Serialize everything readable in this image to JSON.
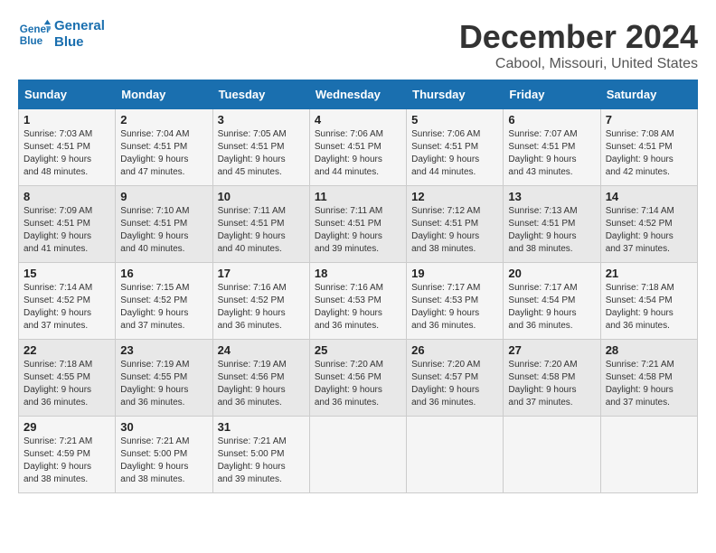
{
  "logo": {
    "line1": "General",
    "line2": "Blue"
  },
  "title": "December 2024",
  "location": "Cabool, Missouri, United States",
  "weekdays": [
    "Sunday",
    "Monday",
    "Tuesday",
    "Wednesday",
    "Thursday",
    "Friday",
    "Saturday"
  ],
  "weeks": [
    [
      {
        "day": "1",
        "sunrise": "7:03 AM",
        "sunset": "4:51 PM",
        "daylight": "9 hours and 48 minutes."
      },
      {
        "day": "2",
        "sunrise": "7:04 AM",
        "sunset": "4:51 PM",
        "daylight": "9 hours and 47 minutes."
      },
      {
        "day": "3",
        "sunrise": "7:05 AM",
        "sunset": "4:51 PM",
        "daylight": "9 hours and 45 minutes."
      },
      {
        "day": "4",
        "sunrise": "7:06 AM",
        "sunset": "4:51 PM",
        "daylight": "9 hours and 44 minutes."
      },
      {
        "day": "5",
        "sunrise": "7:06 AM",
        "sunset": "4:51 PM",
        "daylight": "9 hours and 44 minutes."
      },
      {
        "day": "6",
        "sunrise": "7:07 AM",
        "sunset": "4:51 PM",
        "daylight": "9 hours and 43 minutes."
      },
      {
        "day": "7",
        "sunrise": "7:08 AM",
        "sunset": "4:51 PM",
        "daylight": "9 hours and 42 minutes."
      }
    ],
    [
      {
        "day": "8",
        "sunrise": "7:09 AM",
        "sunset": "4:51 PM",
        "daylight": "9 hours and 41 minutes."
      },
      {
        "day": "9",
        "sunrise": "7:10 AM",
        "sunset": "4:51 PM",
        "daylight": "9 hours and 40 minutes."
      },
      {
        "day": "10",
        "sunrise": "7:11 AM",
        "sunset": "4:51 PM",
        "daylight": "9 hours and 40 minutes."
      },
      {
        "day": "11",
        "sunrise": "7:11 AM",
        "sunset": "4:51 PM",
        "daylight": "9 hours and 39 minutes."
      },
      {
        "day": "12",
        "sunrise": "7:12 AM",
        "sunset": "4:51 PM",
        "daylight": "9 hours and 38 minutes."
      },
      {
        "day": "13",
        "sunrise": "7:13 AM",
        "sunset": "4:51 PM",
        "daylight": "9 hours and 38 minutes."
      },
      {
        "day": "14",
        "sunrise": "7:14 AM",
        "sunset": "4:52 PM",
        "daylight": "9 hours and 37 minutes."
      }
    ],
    [
      {
        "day": "15",
        "sunrise": "7:14 AM",
        "sunset": "4:52 PM",
        "daylight": "9 hours and 37 minutes."
      },
      {
        "day": "16",
        "sunrise": "7:15 AM",
        "sunset": "4:52 PM",
        "daylight": "9 hours and 37 minutes."
      },
      {
        "day": "17",
        "sunrise": "7:16 AM",
        "sunset": "4:52 PM",
        "daylight": "9 hours and 36 minutes."
      },
      {
        "day": "18",
        "sunrise": "7:16 AM",
        "sunset": "4:53 PM",
        "daylight": "9 hours and 36 minutes."
      },
      {
        "day": "19",
        "sunrise": "7:17 AM",
        "sunset": "4:53 PM",
        "daylight": "9 hours and 36 minutes."
      },
      {
        "day": "20",
        "sunrise": "7:17 AM",
        "sunset": "4:54 PM",
        "daylight": "9 hours and 36 minutes."
      },
      {
        "day": "21",
        "sunrise": "7:18 AM",
        "sunset": "4:54 PM",
        "daylight": "9 hours and 36 minutes."
      }
    ],
    [
      {
        "day": "22",
        "sunrise": "7:18 AM",
        "sunset": "4:55 PM",
        "daylight": "9 hours and 36 minutes."
      },
      {
        "day": "23",
        "sunrise": "7:19 AM",
        "sunset": "4:55 PM",
        "daylight": "9 hours and 36 minutes."
      },
      {
        "day": "24",
        "sunrise": "7:19 AM",
        "sunset": "4:56 PM",
        "daylight": "9 hours and 36 minutes."
      },
      {
        "day": "25",
        "sunrise": "7:20 AM",
        "sunset": "4:56 PM",
        "daylight": "9 hours and 36 minutes."
      },
      {
        "day": "26",
        "sunrise": "7:20 AM",
        "sunset": "4:57 PM",
        "daylight": "9 hours and 36 minutes."
      },
      {
        "day": "27",
        "sunrise": "7:20 AM",
        "sunset": "4:58 PM",
        "daylight": "9 hours and 37 minutes."
      },
      {
        "day": "28",
        "sunrise": "7:21 AM",
        "sunset": "4:58 PM",
        "daylight": "9 hours and 37 minutes."
      }
    ],
    [
      {
        "day": "29",
        "sunrise": "7:21 AM",
        "sunset": "4:59 PM",
        "daylight": "9 hours and 38 minutes."
      },
      {
        "day": "30",
        "sunrise": "7:21 AM",
        "sunset": "5:00 PM",
        "daylight": "9 hours and 38 minutes."
      },
      {
        "day": "31",
        "sunrise": "7:21 AM",
        "sunset": "5:00 PM",
        "daylight": "9 hours and 39 minutes."
      },
      null,
      null,
      null,
      null
    ]
  ]
}
